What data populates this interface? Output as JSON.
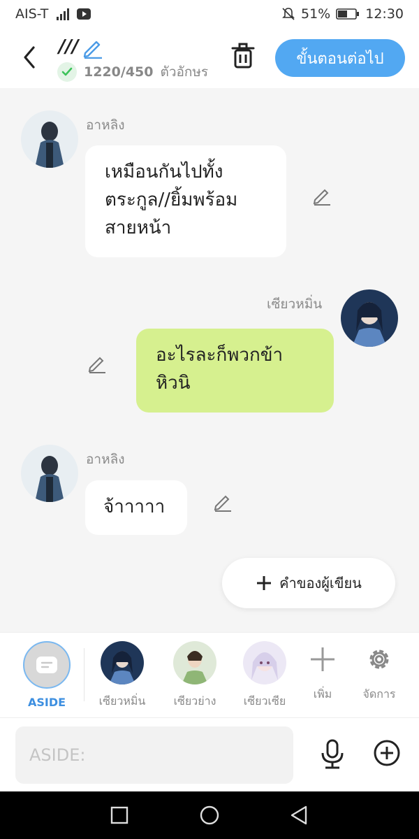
{
  "status": {
    "carrier": "AIS-T",
    "battery": "51%",
    "time": "12:30"
  },
  "header": {
    "title": "///",
    "char_count": "1220/450",
    "count_label": "ตัวอักษร",
    "next_label": "ขั้นตอนต่อไป"
  },
  "messages": [
    {
      "name": "อาหลิง",
      "text": "เหมือนกันไปทั้ง\nตระกูล//ยิ้มพร้อม\nสายหน้า",
      "side": "left"
    },
    {
      "name": "เซียวหมิ่น",
      "text": "อะไรละก็พวกข้า\nหิวนิ",
      "side": "right"
    },
    {
      "name": "อาหลิง",
      "text": "จ้าาาาา",
      "side": "left"
    }
  ],
  "writer_button": {
    "label": "คำของผู้เขียน"
  },
  "characters": {
    "aside_label": "ASIDE",
    "items": [
      {
        "label": "เซียวหมิ่น"
      },
      {
        "label": "เซียวย่าง"
      },
      {
        "label": "เซียวเซีย"
      }
    ],
    "add_label": "เพิ่ม",
    "manage_label": "จัดการ"
  },
  "input": {
    "placeholder": "ASIDE:"
  },
  "colors": {
    "accent": "#52a8f2",
    "bubble_green": "#d6f08f",
    "aside_label": "#3d8fe0"
  }
}
